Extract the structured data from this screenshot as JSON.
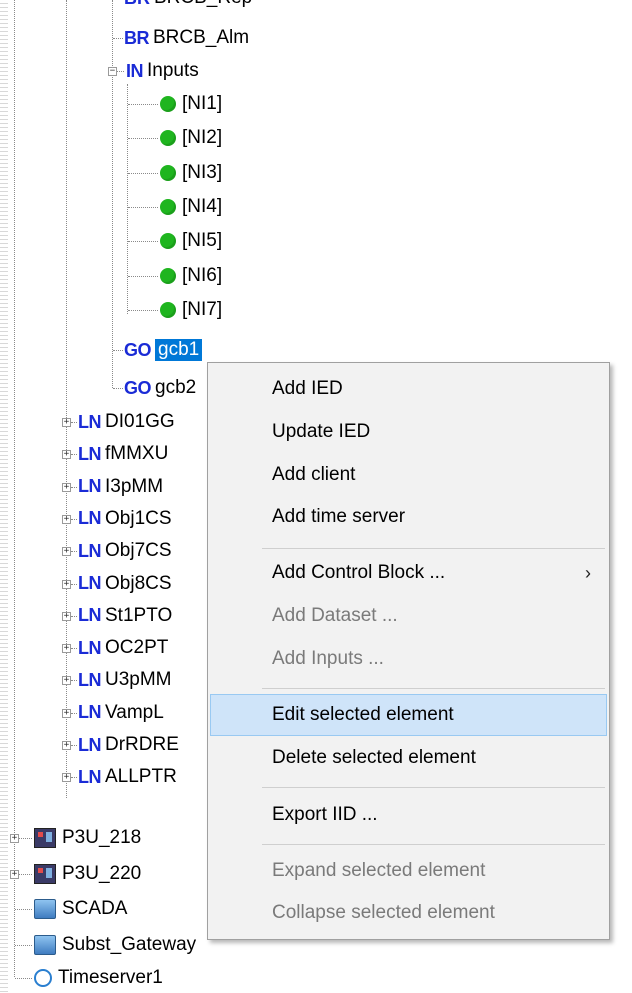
{
  "tree": {
    "top_partial": "BRCB...",
    "brcb": {
      "tag": "BR",
      "label": "BRCB_Alm"
    },
    "inputs": {
      "tag": "IN",
      "label": "Inputs"
    },
    "ni_items": [
      "[NI1]",
      "[NI2]",
      "[NI3]",
      "[NI4]",
      "[NI5]",
      "[NI6]",
      "[NI7]"
    ],
    "go1": {
      "tag": "GO",
      "label": "gcb1"
    },
    "go2": {
      "tag": "GO",
      "label": "gcb2"
    },
    "ln_items": [
      {
        "tag": "LN",
        "label": "DI01GG"
      },
      {
        "tag": "LN",
        "label": "fMMXU"
      },
      {
        "tag": "LN",
        "label": "I3pMM"
      },
      {
        "tag": "LN",
        "label": "Obj1CS"
      },
      {
        "tag": "LN",
        "label": "Obj7CS"
      },
      {
        "tag": "LN",
        "label": "Obj8CS"
      },
      {
        "tag": "LN",
        "label": "St1PTO"
      },
      {
        "tag": "LN",
        "label": "OC2PT"
      },
      {
        "tag": "LN",
        "label": "U3pMM"
      },
      {
        "tag": "LN",
        "label": "VampL"
      },
      {
        "tag": "LN",
        "label": "DrRDRE"
      },
      {
        "tag": "LN",
        "label": "ALLPTR"
      }
    ],
    "devices": [
      {
        "label": "P3U_218",
        "icon": "ied-icon"
      },
      {
        "label": "P3U_220",
        "icon": "ied-icon"
      },
      {
        "label": "SCADA",
        "icon": "pc-icon"
      },
      {
        "label": "Subst_Gateway",
        "icon": "pc-icon"
      },
      {
        "label": "Timeserver1",
        "icon": "clock-icon"
      }
    ]
  },
  "context_menu": {
    "add_ied": "Add IED",
    "update_ied": "Update IED",
    "add_client": "Add client",
    "add_time_server": "Add time server",
    "add_control_block": "Add Control Block ...",
    "submenu_arrow": "›",
    "add_dataset": "Add Dataset ...",
    "add_inputs": "Add Inputs ...",
    "edit_selected": "Edit selected element",
    "delete_selected": "Delete selected element",
    "export_iid": "Export IID ...",
    "expand_selected": "Expand selected element",
    "collapse_selected": "Collapse selected element"
  },
  "colors": {
    "tag_blue": "#1a2bd6",
    "selection": "#0078d7",
    "status_green": "#1fb51f",
    "menu_hover": "#cfe4f9"
  }
}
